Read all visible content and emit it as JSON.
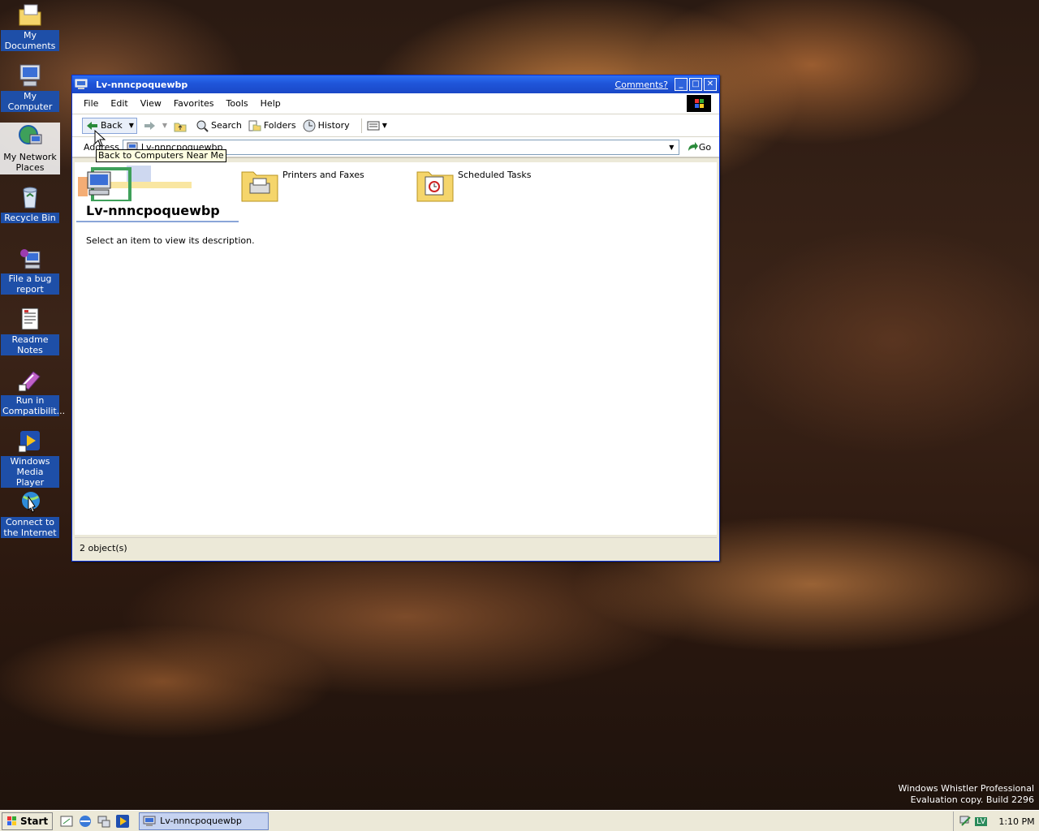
{
  "desktop": {
    "icons": [
      {
        "label": "My Documents",
        "icon": "folder-documents-icon"
      },
      {
        "label": "My Computer",
        "icon": "computer-icon"
      },
      {
        "label": "My Network Places",
        "icon": "network-places-icon"
      },
      {
        "label": "Recycle Bin",
        "icon": "recycle-bin-icon"
      },
      {
        "label": "File a bug report",
        "icon": "bug-report-icon"
      },
      {
        "label": "Readme Notes",
        "icon": "readme-notes-icon"
      },
      {
        "label": "Run in Compatibilit...",
        "icon": "compatibility-icon"
      },
      {
        "label": "Windows Media Player",
        "icon": "media-player-icon"
      },
      {
        "label": "Connect to the Internet",
        "icon": "connect-internet-icon"
      }
    ],
    "watermark": {
      "line1": "Windows Whistler Professional",
      "line2": "Evaluation copy. Build 2296"
    }
  },
  "window": {
    "title": "Lv-nnncpoquewbp",
    "comments_link": "Comments?",
    "menu": [
      "File",
      "Edit",
      "View",
      "Favorites",
      "Tools",
      "Help"
    ],
    "toolbar": {
      "back_label": "Back",
      "search_label": "Search",
      "folders_label": "Folders",
      "history_label": "History"
    },
    "address": {
      "label": "Address",
      "value": "Lv-nnncpoquewbp",
      "go_label": "Go"
    },
    "tooltip": "Back to Computers Near Me",
    "webview": {
      "title": "Lv-nnncpoquewbp",
      "description": "Select an item to view its description."
    },
    "items": [
      {
        "label": "Printers and Faxes",
        "icon": "printers-folder-icon"
      },
      {
        "label": "Scheduled Tasks",
        "icon": "scheduled-tasks-folder-icon"
      }
    ],
    "status": "2 object(s)"
  },
  "taskbar": {
    "start_label": "Start",
    "task_label": "Lv-nnncpoquewbp",
    "tray_badge": "LV",
    "clock": "1:10 PM"
  },
  "colors": {
    "titlebar": "#1f55d9",
    "desktop_label_bg": "#1e4fa8"
  }
}
